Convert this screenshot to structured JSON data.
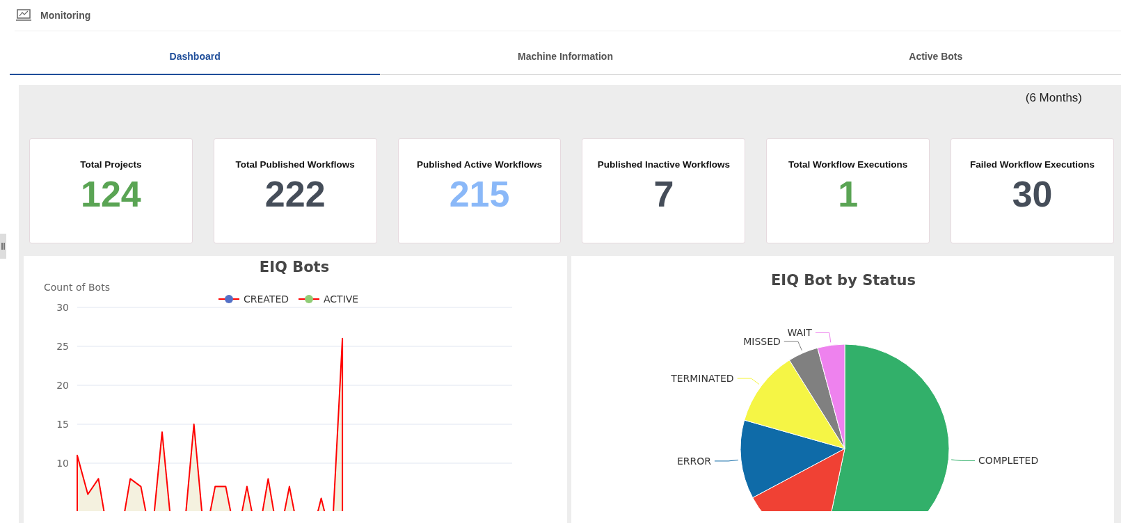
{
  "header": {
    "title": "Monitoring"
  },
  "tabs": [
    {
      "label": "Dashboard",
      "selected": true
    },
    {
      "label": "Machine Information",
      "selected": false
    },
    {
      "label": "Active Bots",
      "selected": false
    }
  ],
  "period": "(6 Months)",
  "cards": [
    {
      "label": "Total Projects",
      "value": "124",
      "color": "#5aa454"
    },
    {
      "label": "Total Published Workflows",
      "value": "222",
      "color": "#454d59"
    },
    {
      "label": "Published Active Workflows",
      "value": "215",
      "color": "#8ab8f8"
    },
    {
      "label": "Published Inactive Workflows",
      "value": "7",
      "color": "#454d59"
    },
    {
      "label": "Total Workflow Executions",
      "value": "1",
      "color": "#5aa454"
    },
    {
      "label": "Failed Workflow Executions",
      "value": "30",
      "color": "#454d59"
    }
  ],
  "bots_chart": {
    "chart_data": {
      "type": "area",
      "title": "EIQ Bots",
      "ylabel": "Count of Bots",
      "categories": [
        null,
        null,
        null,
        null,
        null,
        null,
        null,
        null,
        null,
        null,
        null,
        null,
        null,
        null,
        null,
        null,
        null,
        null,
        null,
        null,
        null,
        null,
        null,
        null,
        null,
        null,
        null,
        null,
        null,
        null,
        null,
        null,
        null,
        null,
        null,
        null,
        null,
        null,
        null,
        null,
        null,
        null
      ],
      "series": [
        {
          "color": "#ff0000",
          "values": [
            11,
            6,
            8,
            0,
            0,
            8,
            7,
            0,
            14,
            0,
            0,
            15,
            0,
            7,
            7,
            0,
            7,
            0,
            8,
            0,
            7,
            0,
            0,
            5.5,
            0,
            26,
            null,
            null,
            null,
            null,
            null,
            null,
            null,
            null,
            null,
            null,
            null,
            null,
            null,
            null,
            null,
            null
          ]
        }
      ],
      "ylim": [
        0,
        30
      ],
      "yticks": [
        10,
        15,
        20,
        25,
        30
      ],
      "grid": true
    },
    "legend": [
      {
        "label": "CREATED",
        "color": "#5470c6"
      },
      {
        "label": "ACTIVE",
        "color": "#91cc75"
      }
    ]
  },
  "status_chart": {
    "chart_data": {
      "type": "pie",
      "title": "EIQ Bot by Status",
      "categories": [
        "COMPLETED",
        null,
        "ERROR",
        "TERMINATED",
        "MISSED",
        "WAIT"
      ],
      "values": [
        53.3,
        13.9,
        12.2,
        11.7,
        4.7,
        4.2
      ],
      "colors": [
        "#32b06a",
        "#f04134",
        "#0f6ba8",
        "#f5f545",
        "#808080",
        "#ee82ee"
      ]
    }
  }
}
